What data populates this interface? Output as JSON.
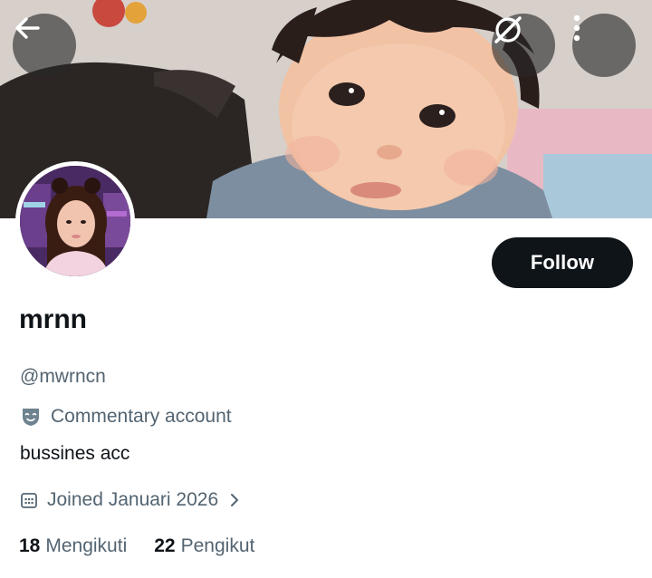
{
  "banner": {
    "back_icon": "arrow-left-icon",
    "grok_icon": "grok-icon",
    "more_icon": "more-vertical-icon"
  },
  "profile": {
    "display_name": "mrnn",
    "handle": "@mwrncn",
    "label_icon": "mask-icon",
    "label": "Commentary account",
    "bio": "bussines acc",
    "joined_icon": "calendar-icon",
    "joined": "Joined Januari 2026",
    "joined_chevron": "chevron-right-icon"
  },
  "actions": {
    "follow_label": "Follow"
  },
  "stats": {
    "following_count": "18",
    "following_label": "Mengikuti",
    "followers_count": "22",
    "followers_label": "Pengikut"
  },
  "colors": {
    "primary_text": "#0f1419",
    "secondary_text": "#536471",
    "follow_bg": "#0f1419",
    "overlay_button": "#282828"
  }
}
